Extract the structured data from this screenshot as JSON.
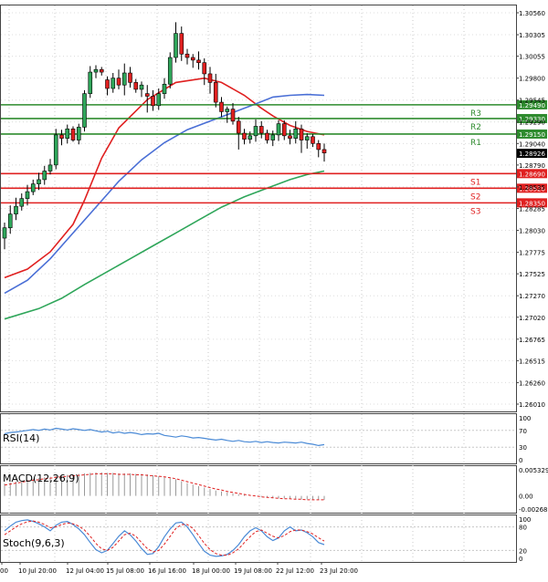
{
  "chart_data": [
    {
      "type": "candlestick",
      "title": "",
      "ylim": [
        1.2601,
        1.3056
      ],
      "y_ticks": [
        "1.30560",
        "1.30305",
        "1.30055",
        "1.29800",
        "1.29545",
        "1.29290",
        "1.29040",
        "1.28790",
        "1.28535",
        "1.28285",
        "1.28030",
        "1.27775",
        "1.27525",
        "1.27270",
        "1.27020",
        "1.26765",
        "1.26515",
        "1.26260",
        "1.26010"
      ],
      "current_price": "1.28926",
      "x_ticks": [
        "00",
        "10 Jul 20:00",
        "12 Jul 04:00",
        "15 Jul 08:00",
        "16 Jul 16:00",
        "18 Jul 00:00",
        "19 Jul 08:00",
        "22 Jul 12:00",
        "23 Jul 20:00"
      ],
      "candles": [
        {
          "o": 1.2794,
          "h": 1.2812,
          "l": 1.2781,
          "c": 1.2806
        },
        {
          "o": 1.2806,
          "h": 1.2832,
          "l": 1.2799,
          "c": 1.2822
        },
        {
          "o": 1.2822,
          "h": 1.2841,
          "l": 1.2815,
          "c": 1.2831
        },
        {
          "o": 1.2831,
          "h": 1.2846,
          "l": 1.2826,
          "c": 1.284
        },
        {
          "o": 1.284,
          "h": 1.2856,
          "l": 1.2832,
          "c": 1.2848
        },
        {
          "o": 1.2848,
          "h": 1.2862,
          "l": 1.2844,
          "c": 1.2857
        },
        {
          "o": 1.2857,
          "h": 1.287,
          "l": 1.285,
          "c": 1.2862
        },
        {
          "o": 1.2862,
          "h": 1.2878,
          "l": 1.2856,
          "c": 1.2872
        },
        {
          "o": 1.2872,
          "h": 1.2886,
          "l": 1.2868,
          "c": 1.2879
        },
        {
          "o": 1.2879,
          "h": 1.2921,
          "l": 1.2874,
          "c": 1.2914
        },
        {
          "o": 1.2914,
          "h": 1.292,
          "l": 1.2902,
          "c": 1.291
        },
        {
          "o": 1.291,
          "h": 1.2926,
          "l": 1.2904,
          "c": 1.2921
        },
        {
          "o": 1.2921,
          "h": 1.2924,
          "l": 1.2906,
          "c": 1.2908
        },
        {
          "o": 1.2908,
          "h": 1.2927,
          "l": 1.2903,
          "c": 1.2923
        },
        {
          "o": 1.2923,
          "h": 1.2966,
          "l": 1.2918,
          "c": 1.2962
        },
        {
          "o": 1.2962,
          "h": 1.2994,
          "l": 1.2957,
          "c": 1.2987
        },
        {
          "o": 1.2987,
          "h": 1.2995,
          "l": 1.298,
          "c": 1.299
        },
        {
          "o": 1.299,
          "h": 1.2993,
          "l": 1.2983,
          "c": 1.2987
        },
        {
          "o": 1.2978,
          "h": 1.2982,
          "l": 1.296,
          "c": 1.2968
        },
        {
          "o": 1.2968,
          "h": 1.2986,
          "l": 1.2963,
          "c": 1.298
        },
        {
          "o": 1.298,
          "h": 1.299,
          "l": 1.2967,
          "c": 1.2972
        },
        {
          "o": 1.2972,
          "h": 1.2997,
          "l": 1.296,
          "c": 1.2986
        },
        {
          "o": 1.2986,
          "h": 1.2993,
          "l": 1.2969,
          "c": 1.2975
        },
        {
          "o": 1.2975,
          "h": 1.2979,
          "l": 1.2963,
          "c": 1.2967
        },
        {
          "o": 1.2967,
          "h": 1.2976,
          "l": 1.2958,
          "c": 1.2972
        },
        {
          "o": 1.2962,
          "h": 1.2972,
          "l": 1.294,
          "c": 1.2959
        },
        {
          "o": 1.2959,
          "h": 1.2966,
          "l": 1.2942,
          "c": 1.2948
        },
        {
          "o": 1.2948,
          "h": 1.2968,
          "l": 1.2943,
          "c": 1.2962
        },
        {
          "o": 1.2962,
          "h": 1.298,
          "l": 1.2956,
          "c": 1.2973
        },
        {
          "o": 1.2973,
          "h": 1.301,
          "l": 1.2968,
          "c": 1.3004
        },
        {
          "o": 1.3004,
          "h": 1.3045,
          "l": 1.2998,
          "c": 1.3032
        },
        {
          "o": 1.3032,
          "h": 1.304,
          "l": 1.3,
          "c": 1.3008
        },
        {
          "o": 1.3008,
          "h": 1.3014,
          "l": 1.2996,
          "c": 1.3004
        },
        {
          "o": 1.3004,
          "h": 1.3008,
          "l": 1.2992,
          "c": 1.3001
        },
        {
          "o": 1.3001,
          "h": 1.3011,
          "l": 1.299,
          "c": 1.2998
        },
        {
          "o": 1.2998,
          "h": 1.3003,
          "l": 1.2972,
          "c": 1.2985
        },
        {
          "o": 1.2985,
          "h": 1.2993,
          "l": 1.2962,
          "c": 1.2975
        },
        {
          "o": 1.2975,
          "h": 1.2985,
          "l": 1.2946,
          "c": 1.2952
        },
        {
          "o": 1.2952,
          "h": 1.2958,
          "l": 1.2935,
          "c": 1.2941
        },
        {
          "o": 1.2941,
          "h": 1.2947,
          "l": 1.2928,
          "c": 1.2944
        },
        {
          "o": 1.2944,
          "h": 1.2951,
          "l": 1.2926,
          "c": 1.293
        },
        {
          "o": 1.293,
          "h": 1.2935,
          "l": 1.2897,
          "c": 1.2916
        },
        {
          "o": 1.2916,
          "h": 1.2921,
          "l": 1.2903,
          "c": 1.2909
        },
        {
          "o": 1.2909,
          "h": 1.2918,
          "l": 1.2904,
          "c": 1.2913
        },
        {
          "o": 1.2913,
          "h": 1.2932,
          "l": 1.2906,
          "c": 1.2924
        },
        {
          "o": 1.2924,
          "h": 1.293,
          "l": 1.291,
          "c": 1.2916
        },
        {
          "o": 1.2916,
          "h": 1.292,
          "l": 1.2904,
          "c": 1.2908
        },
        {
          "o": 1.2908,
          "h": 1.2919,
          "l": 1.2901,
          "c": 1.2914
        },
        {
          "o": 1.2914,
          "h": 1.2931,
          "l": 1.2907,
          "c": 1.2927
        },
        {
          "o": 1.2927,
          "h": 1.2931,
          "l": 1.2908,
          "c": 1.2913
        },
        {
          "o": 1.2913,
          "h": 1.292,
          "l": 1.2903,
          "c": 1.291
        },
        {
          "o": 1.291,
          "h": 1.293,
          "l": 1.2904,
          "c": 1.2921
        },
        {
          "o": 1.2921,
          "h": 1.2926,
          "l": 1.2893,
          "c": 1.2908
        },
        {
          "o": 1.2908,
          "h": 1.2916,
          "l": 1.2898,
          "c": 1.2912
        },
        {
          "o": 1.2912,
          "h": 1.2915,
          "l": 1.29,
          "c": 1.2904
        },
        {
          "o": 1.2904,
          "h": 1.2908,
          "l": 1.2888,
          "c": 1.2897
        },
        {
          "o": 1.2897,
          "h": 1.2904,
          "l": 1.2883,
          "c": 1.2893
        }
      ],
      "moving_averages": [
        {
          "color": "#e02020",
          "points": [
            [
              0,
              1.2748
            ],
            [
              4,
              1.2758
            ],
            [
              8,
              1.2778
            ],
            [
              12,
              1.281
            ],
            [
              14,
              1.2838
            ],
            [
              17,
              1.2887
            ],
            [
              20,
              1.2922
            ],
            [
              25,
              1.2955
            ],
            [
              30,
              1.2975
            ],
            [
              35,
              1.298
            ],
            [
              38,
              1.2975
            ],
            [
              42,
              1.296
            ],
            [
              45,
              1.2945
            ],
            [
              47,
              1.2936
            ],
            [
              50,
              1.2925
            ],
            [
              53,
              1.2918
            ],
            [
              56,
              1.2914
            ]
          ]
        },
        {
          "color": "#4a6fd6",
          "points": [
            [
              0,
              1.273
            ],
            [
              4,
              1.2745
            ],
            [
              8,
              1.277
            ],
            [
              12,
              1.28
            ],
            [
              16,
              1.283
            ],
            [
              20,
              1.286
            ],
            [
              24,
              1.2885
            ],
            [
              28,
              1.2905
            ],
            [
              32,
              1.292
            ],
            [
              36,
              1.293
            ],
            [
              40,
              1.294
            ],
            [
              44,
              1.295
            ],
            [
              47,
              1.2958
            ],
            [
              50,
              1.296
            ],
            [
              53,
              1.2961
            ],
            [
              56,
              1.296
            ]
          ]
        },
        {
          "color": "#2fa65a",
          "points": [
            [
              0,
              1.27
            ],
            [
              6,
              1.2712
            ],
            [
              10,
              1.2724
            ],
            [
              14,
              1.274
            ],
            [
              18,
              1.2755
            ],
            [
              22,
              1.277
            ],
            [
              26,
              1.2785
            ],
            [
              30,
              1.28
            ],
            [
              34,
              1.2815
            ],
            [
              38,
              1.283
            ],
            [
              42,
              1.2842
            ],
            [
              46,
              1.2852
            ],
            [
              50,
              1.2862
            ],
            [
              53,
              1.2868
            ],
            [
              56,
              1.2872
            ]
          ]
        }
      ],
      "levels": [
        {
          "name": "R3",
          "value": 1.2949,
          "label": "1.29490",
          "color": "#2e8b2e"
        },
        {
          "name": "R2",
          "value": 1.2933,
          "label": "1.29330",
          "color": "#2e8b2e"
        },
        {
          "name": "R1",
          "value": 1.2915,
          "label": "1.29150",
          "color": "#2e8b2e"
        },
        {
          "name": "S1",
          "value": 1.2869,
          "label": "1.28690",
          "color": "#e02020"
        },
        {
          "name": "S2",
          "value": 1.2852,
          "label": "1.28520",
          "color": "#e02020"
        },
        {
          "name": "S3",
          "value": 1.2835,
          "label": "1.28350",
          "color": "#e02020"
        }
      ]
    },
    {
      "type": "line",
      "indicator": "RSI(14)",
      "ylim": [
        0,
        100
      ],
      "y_ticks": [
        "100",
        "70",
        "30",
        "0"
      ],
      "levels": [
        70,
        30
      ],
      "color": "#4a8ad6",
      "values": [
        62,
        65,
        66,
        68,
        70,
        72,
        70,
        73,
        71,
        75,
        73,
        71,
        74,
        72,
        70,
        72,
        69,
        66,
        68,
        64,
        66,
        63,
        65,
        63,
        60,
        62,
        61,
        63,
        58,
        56,
        54,
        57,
        55,
        52,
        53,
        51,
        49,
        47,
        49,
        46,
        44,
        46,
        43,
        42,
        44,
        41,
        43,
        41,
        40,
        42,
        41,
        40,
        42,
        39,
        37,
        34,
        36
      ]
    },
    {
      "type": "line",
      "indicator": "MACD(12,26,9)",
      "ylim": [
        -0.002689,
        0.005329
      ],
      "y_ticks": [
        "0.005329",
        "0.00",
        "-0.002689"
      ],
      "histogram_color": "#999999",
      "signal_color": "#e02020",
      "histogram": [
        0.0025,
        0.0027,
        0.0029,
        0.0031,
        0.0033,
        0.0035,
        0.0036,
        0.0038,
        0.0039,
        0.0041,
        0.0042,
        0.0043,
        0.0044,
        0.0045,
        0.0046,
        0.0047,
        0.0048,
        0.0048,
        0.0047,
        0.0047,
        0.0046,
        0.0046,
        0.0046,
        0.0045,
        0.0045,
        0.0044,
        0.0042,
        0.004,
        0.0038,
        0.0036,
        0.0034,
        0.003,
        0.0026,
        0.0023,
        0.002,
        0.0017,
        0.0014,
        0.0011,
        0.0009,
        0.0007,
        0.0005,
        0.0003,
        0.0002,
        0.0001,
        0.0,
        -0.0002,
        -0.0003,
        -0.0004,
        -0.0005,
        -0.0005,
        -0.0006,
        -0.0007,
        -0.0007,
        -0.0007,
        -0.0008,
        -0.0008,
        -0.0008
      ],
      "signal": [
        0.0022,
        0.0024,
        0.0026,
        0.0028,
        0.003,
        0.0032,
        0.0033,
        0.0035,
        0.0036,
        0.0038,
        0.0039,
        0.004,
        0.0041,
        0.0042,
        0.0043,
        0.0044,
        0.0045,
        0.0045,
        0.0045,
        0.0045,
        0.0044,
        0.0044,
        0.0044,
        0.0043,
        0.0043,
        0.0042,
        0.0041,
        0.004,
        0.0039,
        0.0037,
        0.0035,
        0.0032,
        0.0029,
        0.0026,
        0.0023,
        0.002,
        0.0017,
        0.0014,
        0.0012,
        0.0009,
        0.0007,
        0.0005,
        0.0003,
        0.0001,
        0.0,
        -0.0002,
        -0.0003,
        -0.0004,
        -0.0005,
        -0.0006,
        -0.0006,
        -0.0007,
        -0.0007,
        -0.0008,
        -0.0008,
        -0.0008,
        -0.0008
      ]
    },
    {
      "type": "line",
      "indicator": "Stoch(9,6,3)",
      "ylim": [
        0,
        100
      ],
      "y_ticks": [
        "100",
        "80",
        "20",
        "0"
      ],
      "levels": [
        80,
        20
      ],
      "main_color": "#4a8ad6",
      "signal_color": "#e02020",
      "main": [
        70,
        82,
        92,
        96,
        98,
        94,
        88,
        80,
        70,
        84,
        92,
        94,
        86,
        75,
        60,
        40,
        22,
        14,
        20,
        38,
        56,
        70,
        60,
        44,
        25,
        10,
        12,
        30,
        55,
        75,
        90,
        92,
        80,
        60,
        38,
        18,
        8,
        5,
        6,
        10,
        20,
        35,
        55,
        70,
        78,
        70,
        55,
        45,
        52,
        70,
        80,
        70,
        72,
        65,
        55,
        40,
        35
      ],
      "signal": [
        60,
        70,
        80,
        88,
        93,
        95,
        92,
        86,
        78,
        80,
        86,
        90,
        88,
        82,
        72,
        56,
        38,
        24,
        20,
        28,
        44,
        60,
        64,
        56,
        40,
        25,
        16,
        20,
        36,
        56,
        76,
        86,
        86,
        76,
        58,
        38,
        22,
        12,
        8,
        8,
        14,
        24,
        40,
        55,
        68,
        72,
        64,
        56,
        52,
        58,
        68,
        72,
        72,
        68,
        62,
        52,
        44
      ]
    }
  ]
}
